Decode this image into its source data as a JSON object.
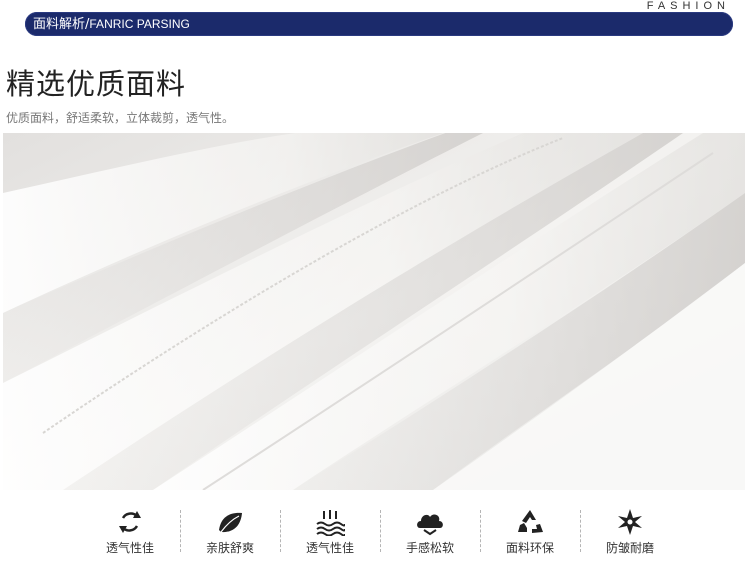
{
  "header": {
    "banner_cn": "面料解析/",
    "banner_en": "FANRIC PARSING",
    "fashion": "FASHION"
  },
  "section": {
    "title": "精选优质面料",
    "subtitle": "优质面料，舒适柔软，立体裁剪，透气性。"
  },
  "colors": {
    "banner": "#1b2a6b",
    "text": "#222222"
  },
  "features": [
    {
      "icon": "recycle-arrows-icon",
      "label": "透气性佳"
    },
    {
      "icon": "leaf-icon",
      "label": "亲肤舒爽"
    },
    {
      "icon": "heat-waves-icon",
      "label": "透气性佳"
    },
    {
      "icon": "cloud-icon",
      "label": "手感松软"
    },
    {
      "icon": "eco-recycle-icon",
      "label": "面料环保"
    },
    {
      "icon": "star-anti-wrinkle-icon",
      "label": "防皱耐磨"
    }
  ]
}
